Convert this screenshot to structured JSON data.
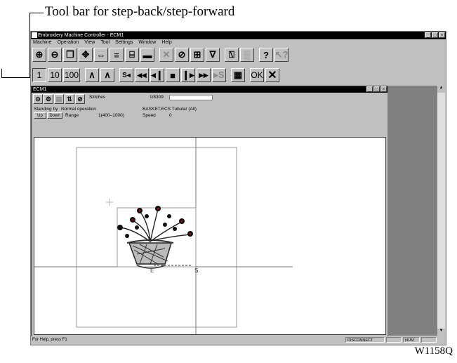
{
  "callout": {
    "text": "Tool bar for step-back/step-forward"
  },
  "app": {
    "title": "Embroidery Machine Controller - ECM1"
  },
  "menu": [
    "Machine",
    "Operation",
    "View",
    "Tool",
    "Settings",
    "Window",
    "Help"
  ],
  "toolbar1": [
    {
      "name": "zoom-in-icon",
      "glyph": "⊕"
    },
    {
      "name": "zoom-out-icon",
      "glyph": "⊖"
    },
    {
      "name": "zoom-area-icon",
      "glyph": "❒"
    },
    {
      "name": "fit-icon",
      "glyph": "✥"
    },
    {
      "name": "move-icon",
      "glyph": "⇔"
    },
    {
      "name": "lines-icon",
      "glyph": "≡"
    },
    {
      "name": "spool-icon",
      "glyph": "⌸"
    },
    {
      "name": "display-icon",
      "glyph": "▬"
    },
    {
      "name": "cancel-icon",
      "glyph": "✕"
    },
    {
      "name": "stop-icon",
      "glyph": "⊘"
    },
    {
      "name": "grid-icon",
      "glyph": "⊞"
    },
    {
      "name": "needle-icon",
      "glyph": "∇"
    },
    {
      "name": "frame-icon",
      "glyph": "⍂"
    },
    {
      "name": "colorbar-icon",
      "glyph": "▒"
    },
    {
      "name": "help-icon",
      "glyph": "?"
    },
    {
      "name": "context-help-icon",
      "glyph": "↖?"
    }
  ],
  "toolbar2": [
    {
      "name": "step-1-button",
      "label": "1"
    },
    {
      "name": "step-10-button",
      "label": "10"
    },
    {
      "name": "step-100-button",
      "label": "100"
    },
    {
      "name": "jump-back-icon",
      "label": "∧"
    },
    {
      "name": "jump-forward-icon",
      "label": "∧"
    },
    {
      "name": "start-back-icon",
      "label": "S◂"
    },
    {
      "name": "fast-back-icon",
      "label": "◂◂"
    },
    {
      "name": "step-back-icon",
      "label": "◂❙"
    },
    {
      "name": "stop-square-icon",
      "label": "■"
    },
    {
      "name": "step-forward-icon",
      "label": "❙▸"
    },
    {
      "name": "fast-forward-icon",
      "label": "▸▸"
    },
    {
      "name": "to-start-icon",
      "label": "▸S"
    },
    {
      "name": "grid-select-icon",
      "label": "▦"
    },
    {
      "name": "ok-button",
      "label": "OK"
    },
    {
      "name": "close-x-icon",
      "label": "✕"
    }
  ],
  "child": {
    "title": "ECM1",
    "stitches_label": "Stitches",
    "stitches_value": "1/8309",
    "status": "Standing by",
    "mode": "Normal operation",
    "file": "BASKET.ECS Tubular (All)",
    "up_label": "Up",
    "down_label": "Down",
    "range_label": "Range",
    "range_value": "1(400–1000)",
    "speed_label": "Speed",
    "speed_value": "0",
    "marker_e": "E",
    "marker_s": "S"
  },
  "status": {
    "help": "For Help, press F1",
    "connection": "DISCONNECT",
    "num": "NUM"
  },
  "figure_code": "W1158Q",
  "colors": {
    "titlebar": "#000000",
    "face": "#c0c0c0",
    "dark_pane": "#808080"
  }
}
